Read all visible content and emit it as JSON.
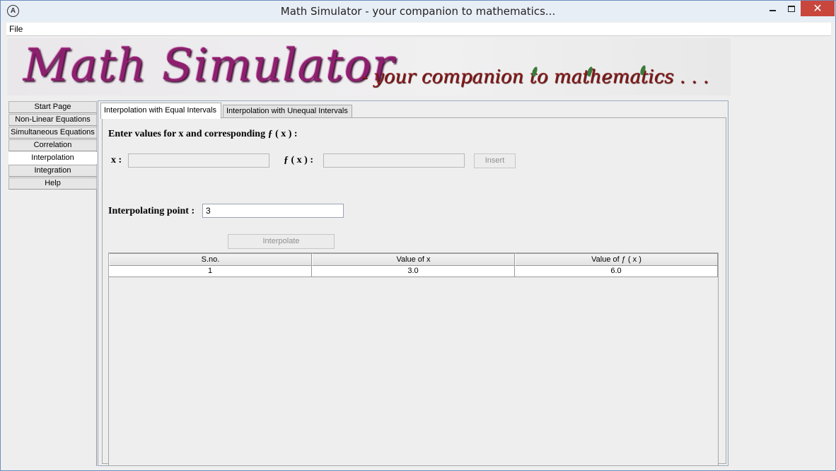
{
  "window": {
    "title": "Math Simulator - your companion to mathematics...",
    "icon": "app-logo-icon"
  },
  "menu": {
    "file": "File"
  },
  "banner": {
    "title": "Math Simulator",
    "subtitle": "- your companion to mathematics . . ."
  },
  "sidebar": {
    "items": [
      {
        "label": "Start Page"
      },
      {
        "label": "Non-Linear Equations"
      },
      {
        "label": "Simultaneous Equations"
      },
      {
        "label": "Correlation"
      },
      {
        "label": "Interpolation"
      },
      {
        "label": "Integration"
      },
      {
        "label": "Help"
      }
    ],
    "active": "Interpolation"
  },
  "tabs": [
    {
      "label": "Interpolation with Equal Intervals"
    },
    {
      "label": "Interpolation with Unequal Intervals"
    }
  ],
  "form": {
    "heading": "Enter values for x and corresponding ƒ ( x )  :",
    "x_label": "x :",
    "fx_label": "ƒ ( x ) :",
    "x_value": "",
    "fx_value": "",
    "insert_label": "Insert",
    "interp_point_label": "Interpolating point :",
    "interp_point_value": "3",
    "interpolate_label": "Interpolate"
  },
  "table": {
    "columns": [
      "S.no.",
      "Value of x",
      "Value of ƒ ( x )"
    ],
    "rows": [
      [
        "1",
        "3.0",
        "6.0"
      ]
    ]
  },
  "colors": {
    "close_button": "#c9463d",
    "banner_title": "#8e1f6f",
    "banner_subtitle": "#8a1c1c"
  }
}
